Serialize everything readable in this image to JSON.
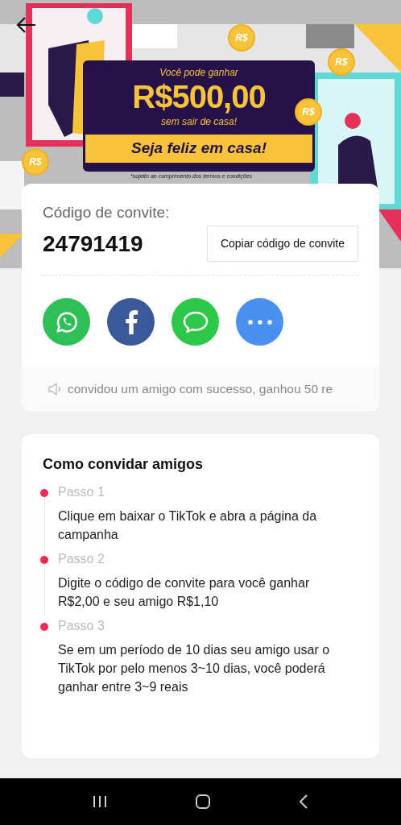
{
  "banner": {
    "kicker": "Você pode ganhar",
    "amount": "R$500,00",
    "subtitle": "sem sair de casa!",
    "cta": "Seja feliz em casa!",
    "disclaimer": "*sujeito ao cumprimento dos termos e condições",
    "coins": [
      "R$",
      "R$",
      "R$",
      "R$"
    ]
  },
  "invite": {
    "label": "Código de convite:",
    "code": "24791419",
    "copy_button": "Copiar código de convite",
    "share": [
      {
        "kind": "whatsapp"
      },
      {
        "kind": "facebook"
      },
      {
        "kind": "message"
      },
      {
        "kind": "more"
      }
    ],
    "ticker": "convidou um amigo com sucesso, ganhou 50 re"
  },
  "howto": {
    "title": "Como convidar amigos",
    "steps": [
      {
        "label": "Passo 1",
        "text": "Clique em baixar o TikTok e abra a página da campanha"
      },
      {
        "label": "Passo 2",
        "text": "Digite o código de convite para você ganhar R$2,00 e seu amigo R$1,10"
      },
      {
        "label": "Passo 3",
        "text": "Se em um período de 10 dias seu amigo usar o TikTok por pelo menos 3~10 dias, você poderá ganhar entre 3~9 reais"
      }
    ]
  }
}
